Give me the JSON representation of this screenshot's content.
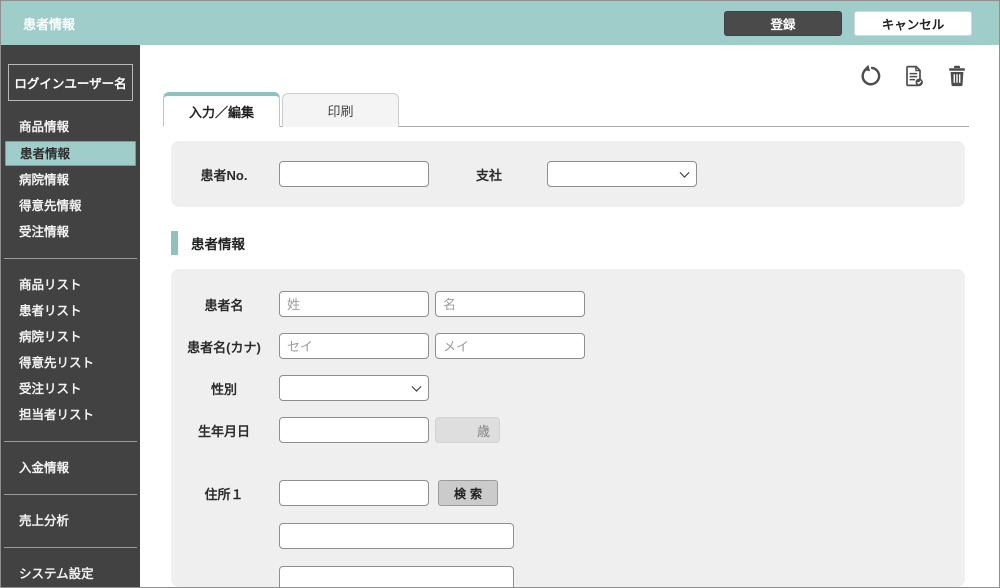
{
  "header": {
    "title": "患者情報",
    "register_label": "登録",
    "cancel_label": "キャンセル"
  },
  "toolbar_icons": {
    "refresh": "refresh-icon",
    "document": "document-check-icon",
    "trash": "trash-icon"
  },
  "sidebar": {
    "login_user_label": "ログインユーザー名",
    "items": [
      {
        "label": "商品情報",
        "active": false
      },
      {
        "label": "患者情報",
        "active": true
      },
      {
        "label": "病院情報",
        "active": false
      },
      {
        "label": "得意先情報",
        "active": false
      },
      {
        "label": "受注情報",
        "active": false
      },
      {
        "label": "商品リスト",
        "active": false
      },
      {
        "label": "患者リスト",
        "active": false
      },
      {
        "label": "病院リスト",
        "active": false
      },
      {
        "label": "得意先リスト",
        "active": false
      },
      {
        "label": "受注リスト",
        "active": false
      },
      {
        "label": "担当者リスト",
        "active": false
      },
      {
        "label": "入金情報",
        "active": false
      },
      {
        "label": "売上分析",
        "active": false
      },
      {
        "label": "システム設定",
        "active": false
      }
    ]
  },
  "tabs": [
    {
      "label": "入力／編集",
      "active": true
    },
    {
      "label": "印刷",
      "active": false
    }
  ],
  "lookup_panel": {
    "patient_no_label": "患者No.",
    "patient_no_value": "",
    "branch_label": "支社",
    "branch_value": ""
  },
  "section_title": "患者情報",
  "patient_form": {
    "name_label": "患者名",
    "last_name_placeholder": "姓",
    "first_name_placeholder": "名",
    "kana_label": "患者名(カナ)",
    "kana_last_placeholder": "セイ",
    "kana_first_placeholder": "メイ",
    "gender_label": "性別",
    "gender_value": "",
    "birthdate_label": "生年月日",
    "birthdate_value": "",
    "age_unit_label": "歳",
    "address1_label": "住所１",
    "address1_value": "",
    "search_button_label": "検索",
    "address2_value": "",
    "address3_value": ""
  },
  "colors": {
    "accent_teal": "#9ecdca",
    "accent_teal_dark": "#8fc2bf",
    "sidebar_bg": "#424242",
    "panel_bg": "#efefef",
    "dark_button": "#4a4a4a"
  }
}
